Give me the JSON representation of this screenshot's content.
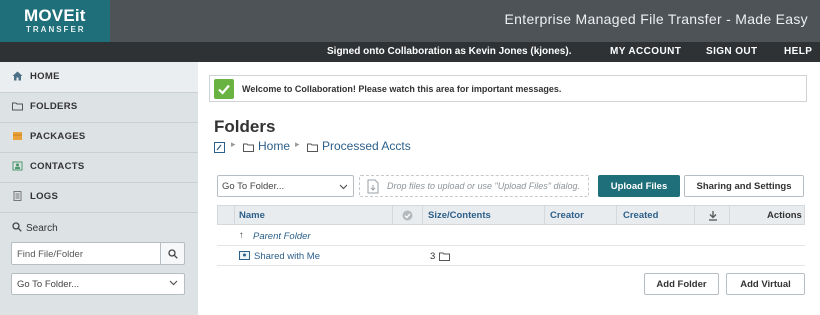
{
  "banner": {
    "logo_main": "MOVEit",
    "logo_sub": "TRANSFER",
    "tagline": "Enterprise Managed File Transfer - Made Easy"
  },
  "navbar": {
    "signed_in": "Signed onto Collaboration as Kevin Jones (kjones).",
    "my_account": "MY ACCOUNT",
    "sign_out": "SIGN OUT",
    "help": "HELP"
  },
  "sidebar": {
    "items": [
      {
        "label": "HOME",
        "icon": "home-icon"
      },
      {
        "label": "FOLDERS",
        "icon": "folder-icon"
      },
      {
        "label": "PACKAGES",
        "icon": "package-icon"
      },
      {
        "label": "CONTACTS",
        "icon": "contacts-icon"
      },
      {
        "label": "LOGS",
        "icon": "logs-icon"
      }
    ],
    "search_label": "Search",
    "search_placeholder": "Find File/Folder",
    "goto_value": "Go To Folder..."
  },
  "main": {
    "message": "Welcome to Collaboration! Please watch this area for important messages.",
    "page_title": "Folders",
    "breadcrumbs": [
      "Home",
      "Processed Accts"
    ],
    "toolbar": {
      "goto_value": "Go To Folder...",
      "drop_text": "Drop files to upload or use \"Upload Files\" dialog.",
      "upload_label": "Upload Files",
      "sharing_label": "Sharing and Settings"
    },
    "table": {
      "columns": [
        "Name",
        "Size/Contents",
        "Creator",
        "Created",
        "Actions"
      ],
      "rows": [
        {
          "name": "Parent Folder",
          "size": ""
        },
        {
          "name": "Shared with Me",
          "size": "3"
        }
      ]
    },
    "buttons": {
      "add_folder": "Add Folder",
      "add_virtual": "Add Virtual"
    }
  },
  "colors": {
    "brand_teal": "#1f6f7a",
    "banner_gray": "#4e5357",
    "nav_dark": "#2e3235",
    "sidebar_bg": "#dde2e5",
    "success_green": "#69b342",
    "link_blue": "#2c5f8a"
  }
}
